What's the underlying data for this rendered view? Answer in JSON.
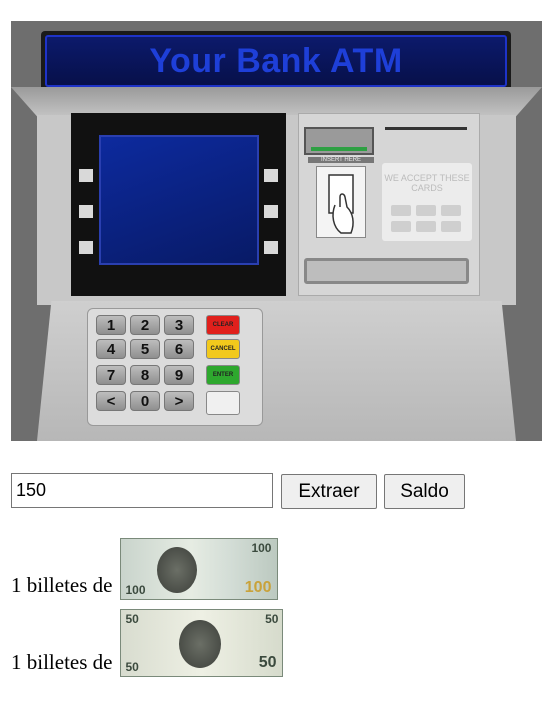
{
  "atm": {
    "sign_text": "Your Bank ATM",
    "insert_label": "INSERT HERE",
    "accept_label": "WE ACCEPT THESE CARDS",
    "keys": [
      "1",
      "2",
      "3",
      "4",
      "5",
      "6",
      "7",
      "8",
      "9",
      "<",
      "0",
      ">"
    ],
    "function_keys": [
      {
        "label": "CLEAR",
        "color": "#e0201c"
      },
      {
        "label": "CANCEL",
        "color": "#f2c91c"
      },
      {
        "label": "ENTER",
        "color": "#2ea82e"
      },
      {
        "label": "",
        "color": "#f0f0f0"
      }
    ]
  },
  "form": {
    "amount_value": "150",
    "extraer_label": "Extraer",
    "saldo_label": "Saldo"
  },
  "results": [
    {
      "text": "1 billetes de",
      "bill": "100-dollar-bill"
    },
    {
      "text": "1 billetes de",
      "bill": "50-dollar-bill"
    }
  ]
}
